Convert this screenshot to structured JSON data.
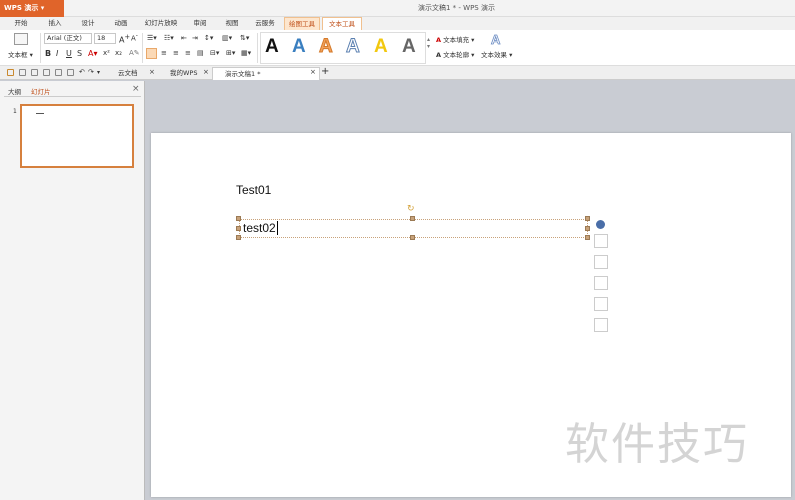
{
  "app": {
    "name": "WPS 演示",
    "window_title": "演示文稿1 * - WPS 演示"
  },
  "tabs": [
    "开始",
    "插入",
    "设计",
    "动画",
    "幻灯片放映",
    "审阅",
    "视图",
    "云服务",
    "绘图工具",
    "文本工具"
  ],
  "ribbon": {
    "textbox_label": "文本框",
    "font_name": "Arial (正文)",
    "font_size": "18",
    "bold": "B",
    "italic": "I",
    "underline": "U",
    "strike": "S",
    "wordart_letter": "A",
    "text_fill": "文本填充",
    "text_outline": "文本轮廓",
    "text_effect": "文本效果"
  },
  "doc_tabs": [
    {
      "label": "云文档"
    },
    {
      "label": "我的WPS"
    },
    {
      "label": "演示文稿1 *"
    }
  ],
  "add_tab": "+",
  "panel": {
    "tab_outline": "大纲",
    "tab_slides": "幻灯片",
    "close": "×",
    "slide_number": "1"
  },
  "slide": {
    "title_text": "Test01",
    "body_text": "test02"
  },
  "watermark": "软件技巧"
}
